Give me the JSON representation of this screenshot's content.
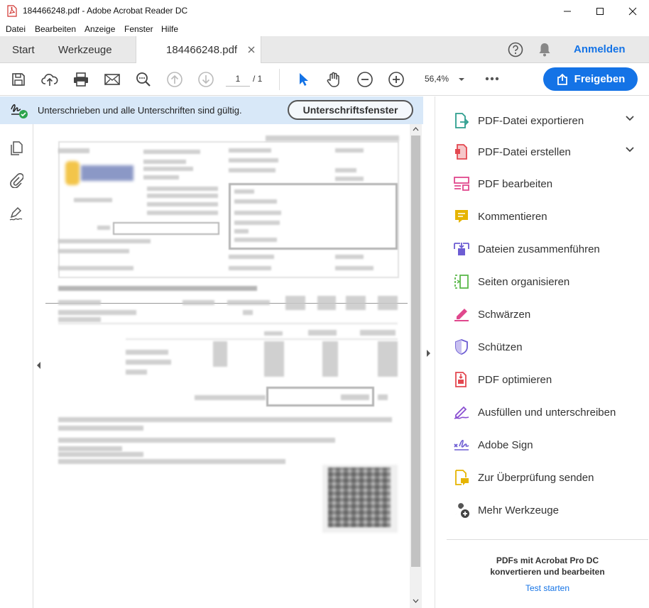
{
  "window": {
    "title": "184466248.pdf - Adobe Acrobat Reader DC"
  },
  "menu": {
    "items": [
      "Datei",
      "Bearbeiten",
      "Anzeige",
      "Fenster",
      "Hilfe"
    ]
  },
  "tabs": {
    "start": "Start",
    "tools": "Werkzeuge",
    "document": "184466248.pdf",
    "sign_in": "Anmelden"
  },
  "toolbar": {
    "page_current": "1",
    "page_total": "/ 1",
    "zoom": "56,4%",
    "share": "Freigeben"
  },
  "signature_bar": {
    "message": "Unterschrieben und alle Unterschriften sind gültig.",
    "button": "Unterschriftsfenster"
  },
  "tools_panel": {
    "items": [
      {
        "label": "PDF-Datei exportieren",
        "icon": "export-pdf-icon",
        "color": "#2e9e8f",
        "expandable": true
      },
      {
        "label": "PDF-Datei erstellen",
        "icon": "create-pdf-icon",
        "color": "#e34850",
        "expandable": true
      },
      {
        "label": "PDF bearbeiten",
        "icon": "edit-pdf-icon",
        "color": "#e0488d",
        "expandable": false
      },
      {
        "label": "Kommentieren",
        "icon": "comment-icon",
        "color": "#e6b400",
        "expandable": false
      },
      {
        "label": "Dateien zusammenführen",
        "icon": "combine-files-icon",
        "color": "#6d5dd3",
        "expandable": false
      },
      {
        "label": "Seiten organisieren",
        "icon": "organize-pages-icon",
        "color": "#5bb84a",
        "expandable": false
      },
      {
        "label": "Schwärzen",
        "icon": "redact-icon",
        "color": "#e0488d",
        "expandable": false
      },
      {
        "label": "Schützen",
        "icon": "protect-icon",
        "color": "#6d5dd3",
        "expandable": false
      },
      {
        "label": "PDF optimieren",
        "icon": "optimize-pdf-icon",
        "color": "#e34850",
        "expandable": false
      },
      {
        "label": "Ausfüllen und unterschreiben",
        "icon": "fill-sign-icon",
        "color": "#8a4fd1",
        "expandable": false
      },
      {
        "label": "Adobe Sign",
        "icon": "adobe-sign-icon",
        "color": "#6d5dd3",
        "expandable": false
      },
      {
        "label": "Zur Überprüfung senden",
        "icon": "send-review-icon",
        "color": "#e6b400",
        "expandable": false
      },
      {
        "label": "Mehr Werkzeuge",
        "icon": "more-tools-icon",
        "color": "#444444",
        "expandable": false
      }
    ],
    "promo_line1": "PDFs mit Acrobat Pro DC",
    "promo_line2": "konvertieren und bearbeiten",
    "promo_link": "Test starten"
  },
  "colors": {
    "accent": "#1473e6",
    "signature_bar_bg": "#d8e8f8",
    "tab_bar_bg": "#e9e9e9"
  }
}
